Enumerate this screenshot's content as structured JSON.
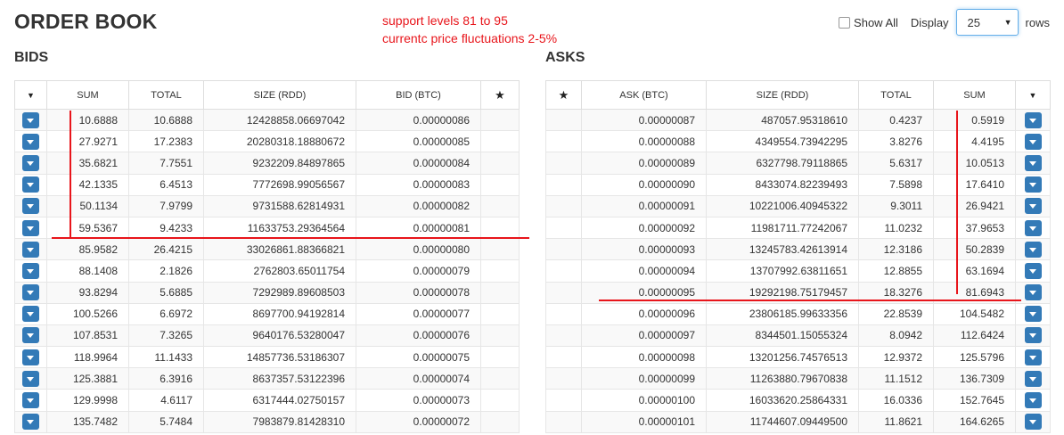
{
  "page": {
    "title": "ORDER BOOK"
  },
  "annotation": {
    "line1": "support levels 81 to 95",
    "line2": "currentc price fluctuations 2-5%",
    "color": "#e8151b"
  },
  "controls": {
    "show_all_label": "Show All",
    "display_label": "Display",
    "rows_value": "25",
    "rows_label": "rows"
  },
  "bids": {
    "title": "BIDS",
    "columns": [
      "SUM",
      "TOTAL",
      "SIZE (RDD)",
      "BID (BTC)"
    ],
    "rows": [
      [
        "10.6888",
        "10.6888",
        "12428858.06697042",
        "0.00000086"
      ],
      [
        "27.9271",
        "17.2383",
        "20280318.18880672",
        "0.00000085"
      ],
      [
        "35.6821",
        "7.7551",
        "9232209.84897865",
        "0.00000084"
      ],
      [
        "42.1335",
        "6.4513",
        "7772698.99056567",
        "0.00000083"
      ],
      [
        "50.1134",
        "7.9799",
        "9731588.62814931",
        "0.00000082"
      ],
      [
        "59.5367",
        "9.4233",
        "11633753.29364564",
        "0.00000081"
      ],
      [
        "85.9582",
        "26.4215",
        "33026861.88366821",
        "0.00000080"
      ],
      [
        "88.1408",
        "2.1826",
        "2762803.65011754",
        "0.00000079"
      ],
      [
        "93.8294",
        "5.6885",
        "7292989.89608503",
        "0.00000078"
      ],
      [
        "100.5266",
        "6.6972",
        "8697700.94192814",
        "0.00000077"
      ],
      [
        "107.8531",
        "7.3265",
        "9640176.53280047",
        "0.00000076"
      ],
      [
        "118.9964",
        "11.1433",
        "14857736.53186307",
        "0.00000075"
      ],
      [
        "125.3881",
        "6.3916",
        "8637357.53122396",
        "0.00000074"
      ],
      [
        "129.9998",
        "4.6117",
        "6317444.02750157",
        "0.00000073"
      ],
      [
        "135.7482",
        "5.7484",
        "7983879.81428310",
        "0.00000072"
      ]
    ]
  },
  "asks": {
    "title": "ASKS",
    "columns": [
      "ASK (BTC)",
      "SIZE (RDD)",
      "TOTAL",
      "SUM"
    ],
    "rows": [
      [
        "0.00000087",
        "487057.95318610",
        "0.4237",
        "0.5919"
      ],
      [
        "0.00000088",
        "4349554.73942295",
        "3.8276",
        "4.4195"
      ],
      [
        "0.00000089",
        "6327798.79118865",
        "5.6317",
        "10.0513"
      ],
      [
        "0.00000090",
        "8433074.82239493",
        "7.5898",
        "17.6410"
      ],
      [
        "0.00000091",
        "10221006.40945322",
        "9.3011",
        "26.9421"
      ],
      [
        "0.00000092",
        "11981711.77242067",
        "11.0232",
        "37.9653"
      ],
      [
        "0.00000093",
        "13245783.42613914",
        "12.3186",
        "50.2839"
      ],
      [
        "0.00000094",
        "13707992.63811651",
        "12.8855",
        "63.1694"
      ],
      [
        "0.00000095",
        "19292198.75179457",
        "18.3276",
        "81.6943"
      ],
      [
        "0.00000096",
        "23806185.99633356",
        "22.8539",
        "104.5482"
      ],
      [
        "0.00000097",
        "8344501.15055324",
        "8.0942",
        "112.6424"
      ],
      [
        "0.00000098",
        "13201256.74576513",
        "12.9372",
        "125.5796"
      ],
      [
        "0.00000099",
        "11263880.79670838",
        "11.1512",
        "136.7309"
      ],
      [
        "0.00000100",
        "16033620.25864331",
        "16.0336",
        "152.7645"
      ],
      [
        "0.00000101",
        "11744607.09449500",
        "11.8621",
        "164.6265"
      ]
    ]
  },
  "icons": {
    "row_action": "chevron-down-icon",
    "column_menu": "caret-down-icon",
    "favorite": "star-icon"
  },
  "colors": {
    "accent": "#337ab7",
    "annotation": "#e8151b"
  }
}
